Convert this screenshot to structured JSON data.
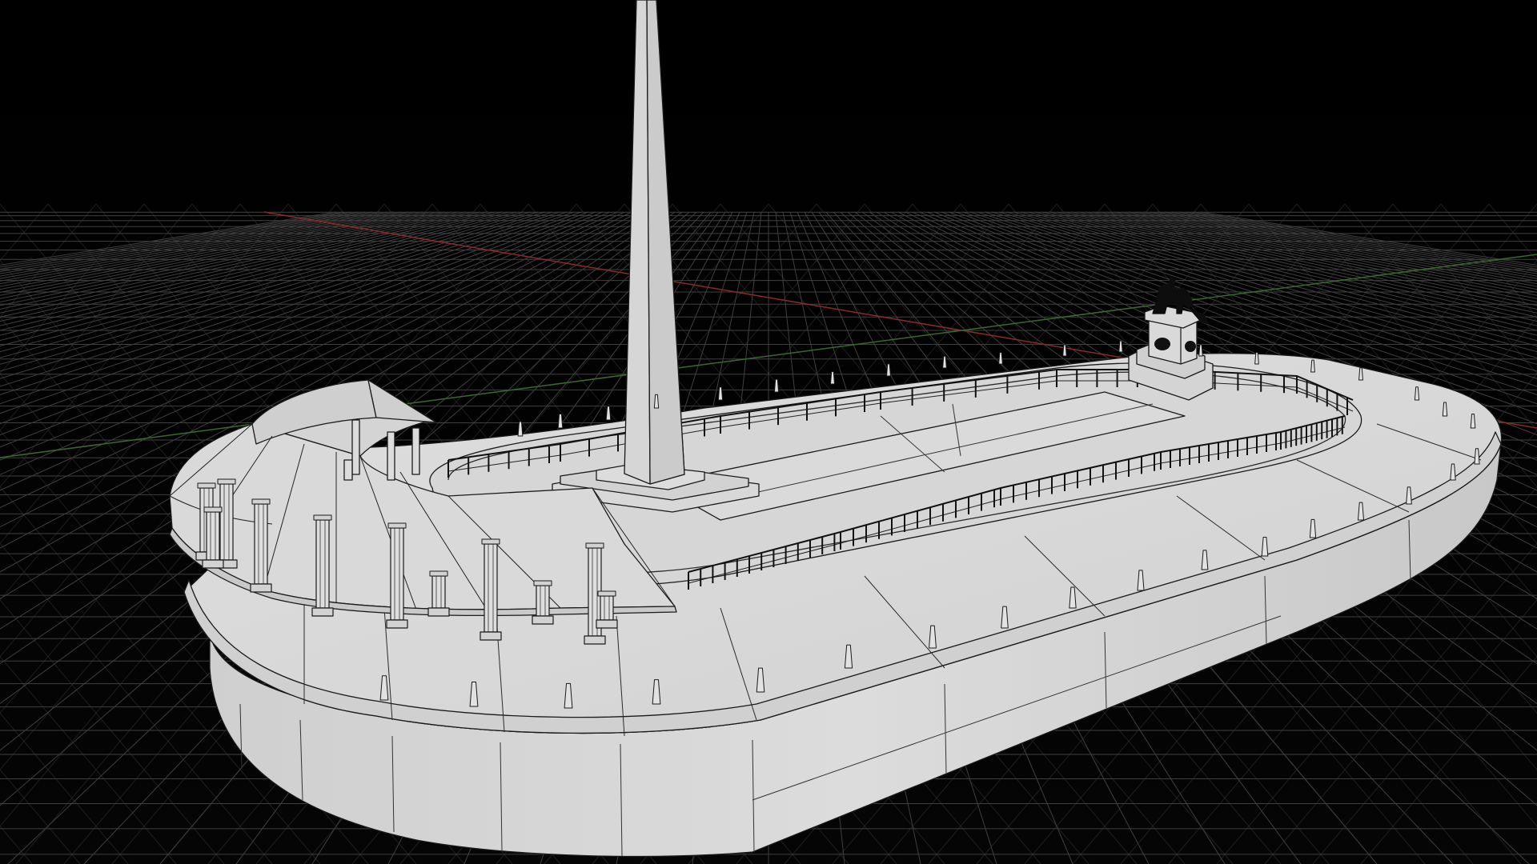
{
  "viewport": {
    "background_color": "#000000",
    "grid_color": "#4a4a4a",
    "axis_x_color": "#8a2a2a",
    "axis_z_color": "#3a6a2a",
    "model_fill": "#d9d9d9",
    "model_fill_shadow": "#bdbdbd",
    "wire_color": "#1a1a1a",
    "statue_color": "#0d0d0d"
  },
  "model": {
    "name": "oval-monument-platform",
    "parts": [
      "obelisk",
      "curved-colonnade-canopy",
      "inner-oval-railing",
      "outer-bollards",
      "statue-pedestal",
      "base-wall"
    ]
  }
}
